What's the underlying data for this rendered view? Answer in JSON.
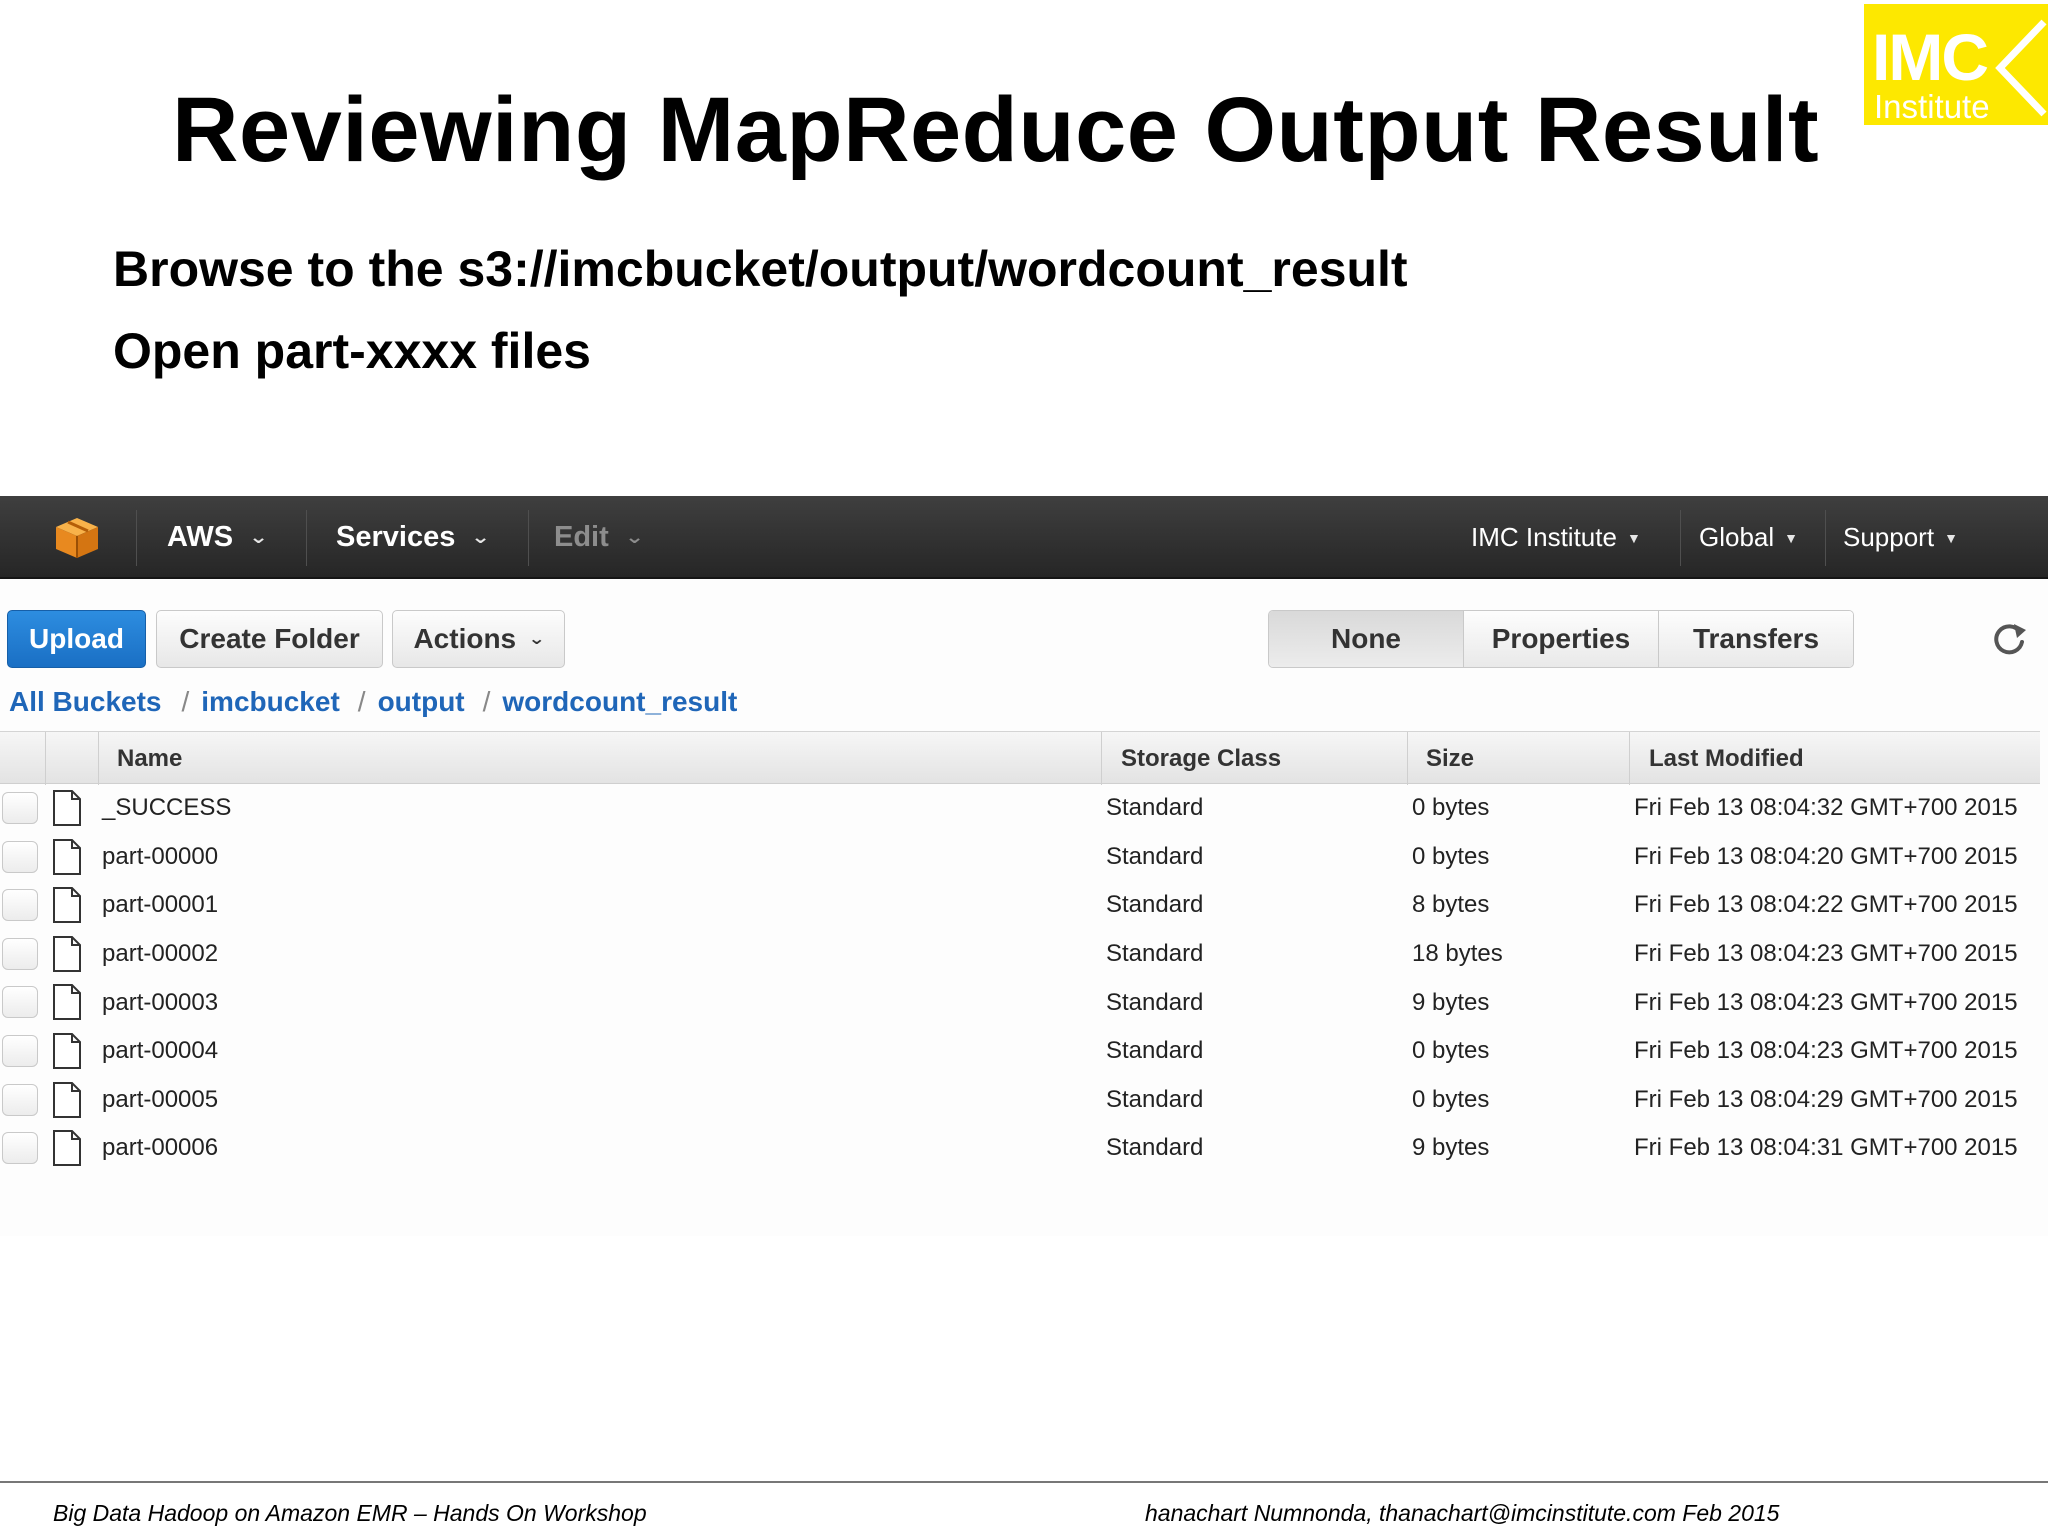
{
  "slide": {
    "title": "Reviewing MapReduce Output Result",
    "logo": {
      "main": "IMC",
      "sub": "Institute",
      "color": "#fde800"
    },
    "bullets": [
      "Browse to the s3://imcbucket/output/wordcount_result",
      "Open part-xxxx files"
    ],
    "footer_left": "Big Data Hadoop on Amazon EMR – Hands On Workshop",
    "footer_right": "hanachart Numnonda,  thanachart@imcinstitute.com   Feb 2015"
  },
  "aws": {
    "navbar": {
      "logo_icon": "aws-cube-icon",
      "items": [
        "AWS",
        "Services",
        "Edit"
      ],
      "right_items": [
        "IMC Institute",
        "Global",
        "Support"
      ]
    },
    "toolbar": {
      "upload": "Upload",
      "create_folder": "Create Folder",
      "actions": "Actions",
      "segments": [
        "None",
        "Properties",
        "Transfers"
      ],
      "refresh_icon": "refresh-icon"
    },
    "breadcrumb": [
      "All Buckets",
      "imcbucket",
      "output",
      "wordcount_result"
    ],
    "table": {
      "columns": [
        "Name",
        "Storage Class",
        "Size",
        "Last Modified"
      ],
      "rows": [
        {
          "name": "_SUCCESS",
          "storage_class": "Standard",
          "size": "0 bytes",
          "last_modified": "Fri Feb 13 08:04:32 GMT+700 2015"
        },
        {
          "name": "part-00000",
          "storage_class": "Standard",
          "size": "0 bytes",
          "last_modified": "Fri Feb 13 08:04:20 GMT+700 2015"
        },
        {
          "name": "part-00001",
          "storage_class": "Standard",
          "size": "8 bytes",
          "last_modified": "Fri Feb 13 08:04:22 GMT+700 2015"
        },
        {
          "name": "part-00002",
          "storage_class": "Standard",
          "size": "18 bytes",
          "last_modified": "Fri Feb 13 08:04:23 GMT+700 2015"
        },
        {
          "name": "part-00003",
          "storage_class": "Standard",
          "size": "9 bytes",
          "last_modified": "Fri Feb 13 08:04:23 GMT+700 2015"
        },
        {
          "name": "part-00004",
          "storage_class": "Standard",
          "size": "0 bytes",
          "last_modified": "Fri Feb 13 08:04:23 GMT+700 2015"
        },
        {
          "name": "part-00005",
          "storage_class": "Standard",
          "size": "0 bytes",
          "last_modified": "Fri Feb 13 08:04:29 GMT+700 2015"
        },
        {
          "name": "part-00006",
          "storage_class": "Standard",
          "size": "9 bytes",
          "last_modified": "Fri Feb 13 08:04:31 GMT+700 2015"
        }
      ]
    }
  }
}
